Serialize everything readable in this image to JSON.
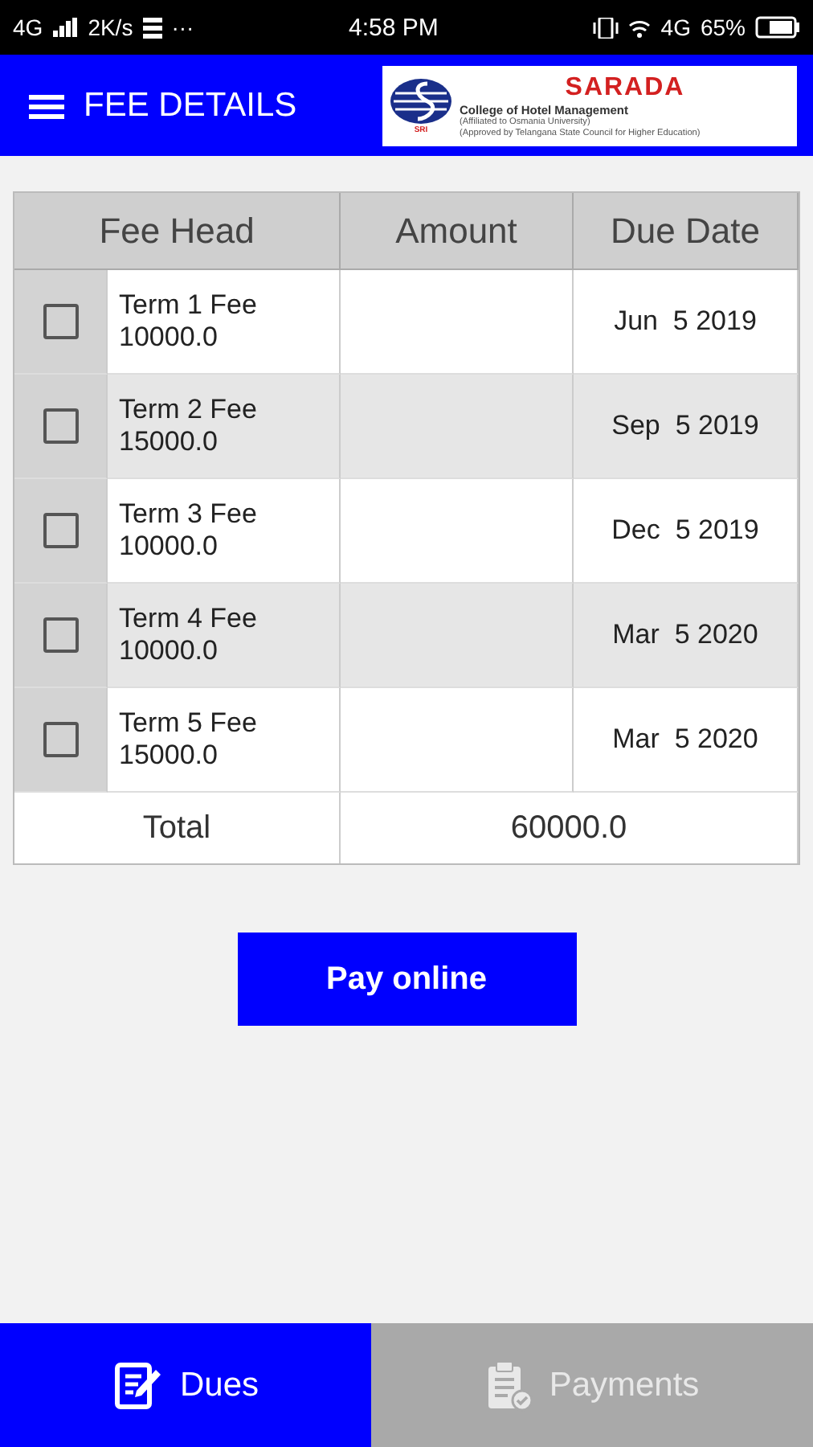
{
  "status_bar": {
    "network": "4G",
    "speed": "2K/s",
    "more": "···",
    "time": "4:58 PM",
    "network_right": "4G",
    "battery": "65%"
  },
  "app_bar": {
    "title": "FEE DETAILS",
    "logo": {
      "name": "SARADA",
      "subtitle": "College of Hotel Management",
      "line_1": "(Affiliated to Osmania University)",
      "line_2": "(Approved by Telangana State Council for Higher Education)",
      "mark": "SRI"
    }
  },
  "table": {
    "columns": [
      "Fee Head",
      "Amount",
      "Due Date"
    ],
    "rows": [
      {
        "checked": false,
        "name": "Term 1 Fee",
        "fee": "10000.0",
        "amount": "",
        "due": "Jun  5 2019"
      },
      {
        "checked": false,
        "name": "Term 2 Fee",
        "fee": "15000.0",
        "amount": "",
        "due": "Sep  5 2019"
      },
      {
        "checked": false,
        "name": "Term 3 Fee",
        "fee": "10000.0",
        "amount": "",
        "due": "Dec  5 2019"
      },
      {
        "checked": false,
        "name": "Term 4 Fee",
        "fee": "10000.0",
        "amount": "",
        "due": "Mar  5 2020"
      },
      {
        "checked": false,
        "name": "Term 5 Fee",
        "fee": "15000.0",
        "amount": "",
        "due": "Mar  5 2020"
      }
    ],
    "total": {
      "label": "Total",
      "value": "60000.0"
    }
  },
  "pay_button": "Pay online",
  "tabs": [
    {
      "label": "Dues",
      "kind": "dues",
      "selected": true
    },
    {
      "label": "Payments",
      "kind": "payments",
      "selected": false
    }
  ]
}
